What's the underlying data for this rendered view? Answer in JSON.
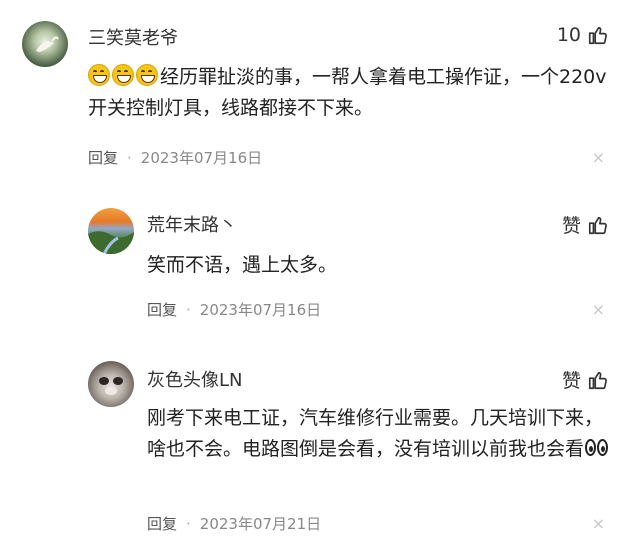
{
  "comments": [
    {
      "username": "三笑莫老爷",
      "likes": "10",
      "text": "经历罪扯淡的事，一帮人拿着电工操作证，一个220v开关控制灯具，线路都接不下来。",
      "reply_label": "回复",
      "separator": "·",
      "date": "2023年07月16日",
      "close": "×"
    },
    {
      "username": "荒年末路丶",
      "likes": "赞",
      "text": "笑而不语，遇上太多。",
      "reply_label": "回复",
      "separator": "·",
      "date": "2023年07月16日",
      "close": "×"
    },
    {
      "username": "灰色头像LN",
      "likes": "赞",
      "text": "刚考下来电工证，汽车维修行业需要。几天培训下来，啥也不会。电路图倒是会看，没有培训以前我也会看",
      "reply_label": "回复",
      "separator": "·",
      "date": "2023年07月21日",
      "close": "×"
    }
  ],
  "icons": {
    "like": "thumbs-up-icon",
    "close": "close-icon",
    "emoji_grin": "grinning-emoji-icon",
    "emoji_eyes": "eyes-emoji-icon"
  },
  "colors": {
    "meta": "#888888",
    "close": "#c8c8c8"
  }
}
